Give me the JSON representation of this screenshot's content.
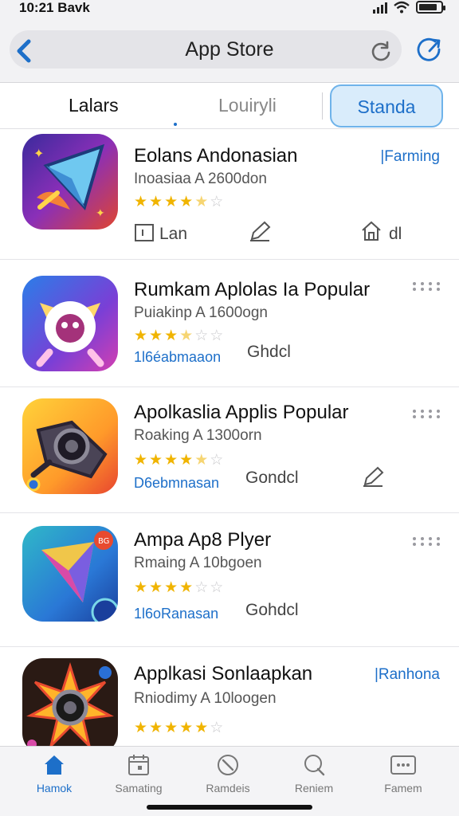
{
  "status_bar": {
    "time": "10:21 Bavk"
  },
  "nav": {
    "title": "App Store"
  },
  "segments": [
    {
      "label": "Lalars"
    },
    {
      "label": "Louiryli"
    },
    {
      "label": "Standa"
    }
  ],
  "apps": [
    {
      "title": "Eolans Andonasian",
      "subtitle": "Inoasiaa A 2600don",
      "rating": 4.5,
      "tag": "|Farming",
      "actions": [
        "Lan",
        "",
        "dl"
      ]
    },
    {
      "title": "Rumkam Aplolas Ia Popular",
      "subtitle": "Puiakinp A 1600ogn",
      "rating": 3.5,
      "link": "1l6éabmaaon",
      "action": "Ghdcl"
    },
    {
      "title": "Apolkaslia Applis Popular",
      "subtitle": "Roaking A 1300orn",
      "rating": 4.5,
      "link": "D6ebmnasan",
      "action": "Gondcl"
    },
    {
      "title": "Ampa Ap8 Plyer",
      "subtitle": "Rmaing A 10bgoen",
      "rating": 4,
      "link": "1l6oRanasan",
      "action": "Gohdcl"
    },
    {
      "title": "Applkasi Sonlaapkan",
      "subtitle": "Rniodimy A 10loogen",
      "rating": 5,
      "tag": "|Ranhona"
    }
  ],
  "tab_bar": [
    {
      "label": "Hamok"
    },
    {
      "label": "Samating"
    },
    {
      "label": "Ramdeis"
    },
    {
      "label": "Reniem"
    },
    {
      "label": "Famem"
    }
  ],
  "colors": {
    "accent": "#1d6fc9",
    "star": "#f0b400"
  }
}
